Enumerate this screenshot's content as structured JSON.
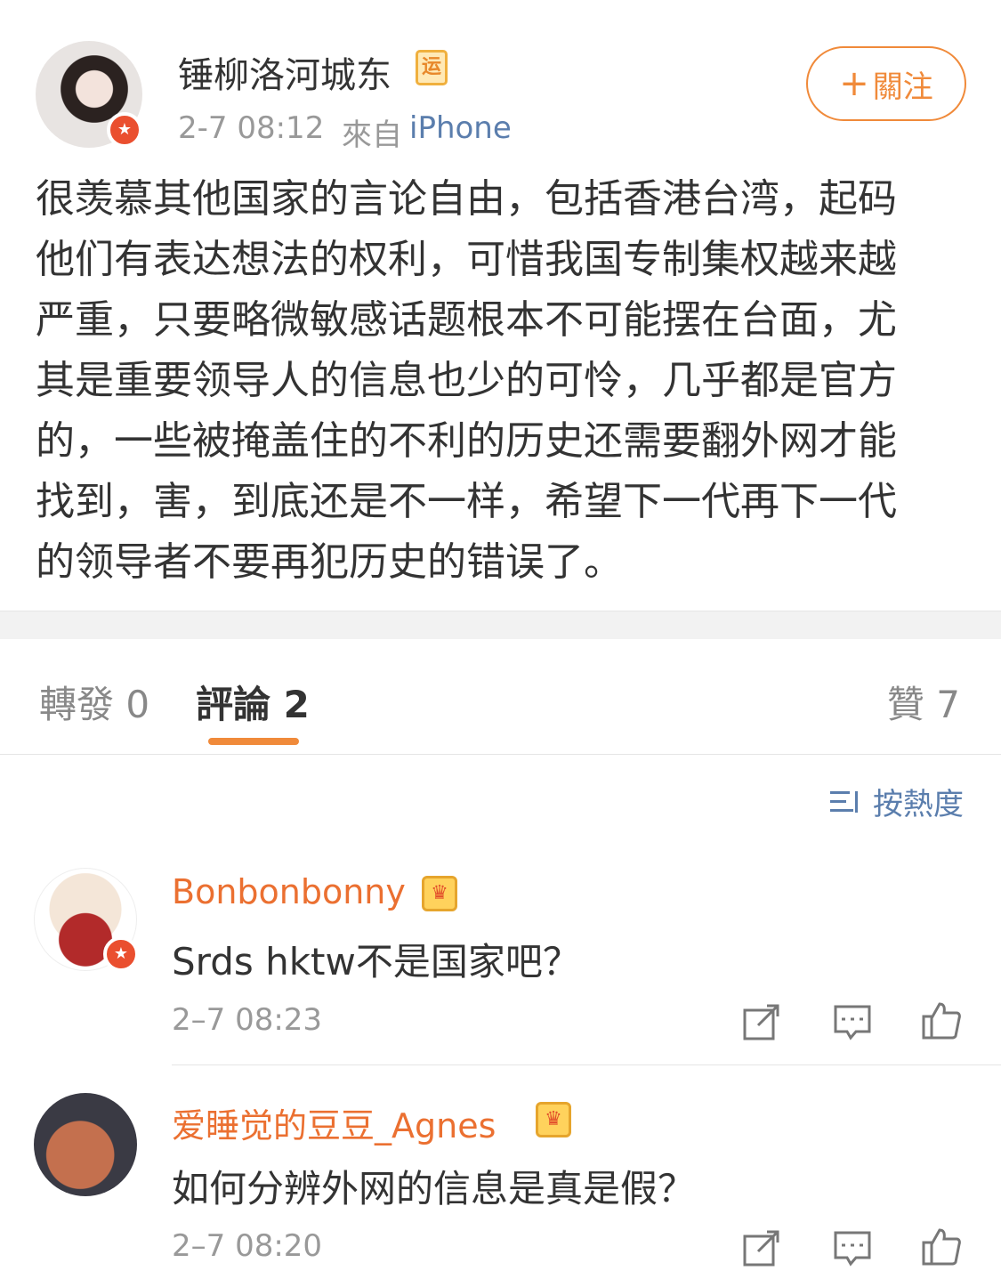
{
  "post": {
    "username": "锤柳洛河城东",
    "vip_tag": "运",
    "time": "2-7 08:12",
    "from_label": "來自",
    "source": "iPhone",
    "follow_label": "關注",
    "follow_plus": "+",
    "body": "很羡慕其他国家的言论自由，包括香港台湾，起码他们有表达想法的权利，可惜我国专制集权越来越严重，只要略微敏感话题根本不可能摆在台面，尤其是重要领导人的信息也少的可怜，几乎都是官方的，一些被掩盖住的不利的历史还需要翻外网才能找到，害，到底还是不一样，希望下一代再下一代的领导者不要再犯历史的错误了。"
  },
  "tabs": {
    "repost": "轉發 0",
    "comment": "評論 2",
    "like": "贊 7"
  },
  "sort": {
    "label": "按熱度"
  },
  "comments": [
    {
      "name": "Bonbonbonny",
      "text": "Srds hktw不是国家吧？",
      "time": "2–7 08:23"
    },
    {
      "name": "爱睡觉的豆豆_Agnes",
      "text": "如何分辨外网的信息是真是假？",
      "time": "2–7 08:20"
    }
  ],
  "colors": {
    "accent": "#f08a3a",
    "link": "#5b7ead",
    "comment_name": "#eb7031"
  }
}
